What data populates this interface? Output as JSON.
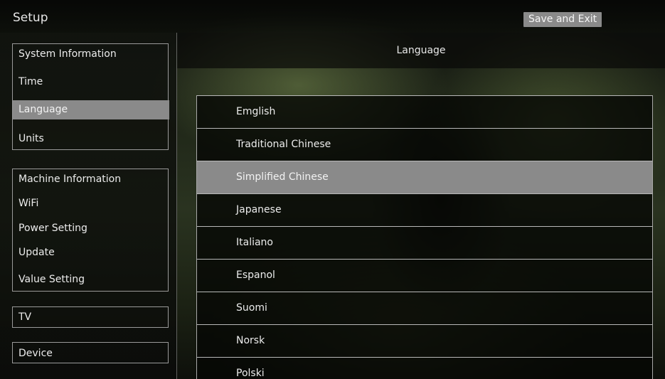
{
  "header": {
    "title": "Setup",
    "save_label": "Save and Exit"
  },
  "sidebar": {
    "groups": [
      {
        "items": [
          "System Information",
          "Time",
          "Language",
          "Units"
        ]
      },
      {
        "items": [
          "Machine Information",
          "WiFi",
          "Power Setting",
          "Update",
          "Value Setting"
        ]
      },
      {
        "items": [
          "TV"
        ]
      },
      {
        "items": [
          "Device"
        ]
      }
    ],
    "selected": "Language"
  },
  "content": {
    "title": "Language",
    "languages": [
      "Emglish",
      "Traditional Chinese",
      "Simplified Chinese",
      "Japanese",
      "Italiano",
      "Espanol",
      "Suomi",
      "Norsk",
      "Polski"
    ],
    "selected": "Simplified Chinese"
  },
  "colors": {
    "highlight": "#8a8a8a",
    "border": "#9a9a9a"
  }
}
